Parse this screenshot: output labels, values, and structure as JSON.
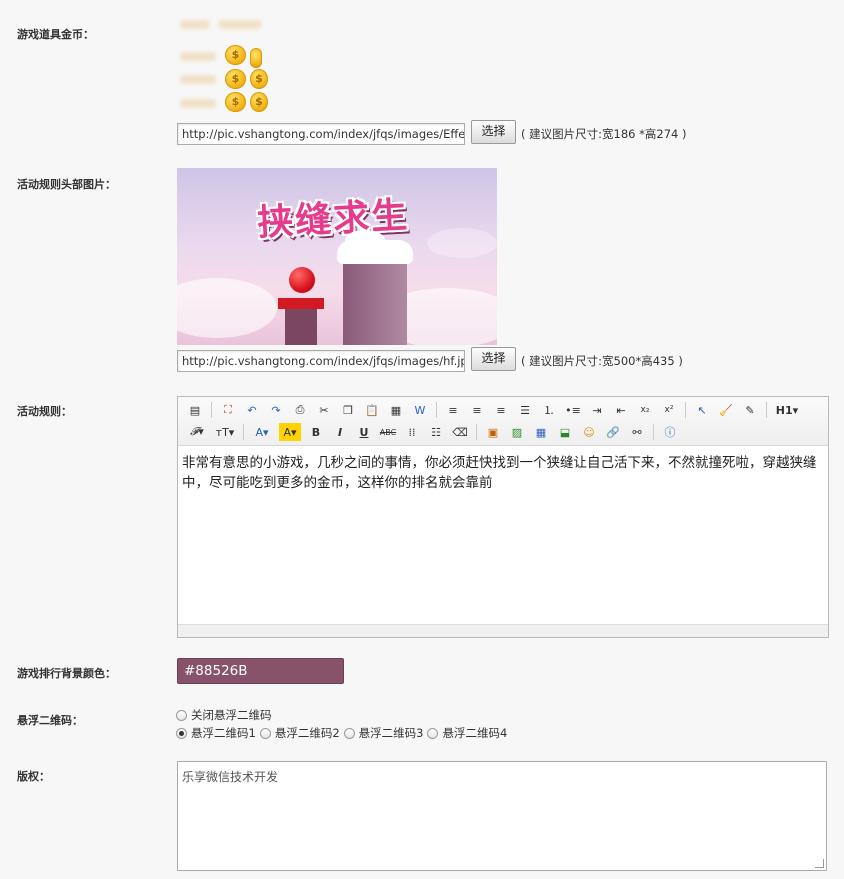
{
  "fields": {
    "coins": {
      "label": "游戏道具金币：",
      "url": "http://pic.vshangtong.com/index/jfqs/images/Effect",
      "button": "选择",
      "hint": "( 建议图片尺寸:宽186 *高274 )"
    },
    "header_image": {
      "label": "活动规则头部图片：",
      "banner_title": "挟缝求生",
      "url": "http://pic.vshangtong.com/index/jfqs/images/hf.jpg",
      "button": "选择",
      "hint": "( 建议图片尺寸:宽500*高435 )"
    },
    "rules": {
      "label": "活动规则：",
      "content": "非常有意思的小游戏，几秒之间的事情，你必须赶快找到一个狭缝让自己活下来，不然就撞死啦，穿越狭缝中，尽可能吃到更多的金币，这样你的排名就会靠前",
      "toolbar_heading": "H1"
    },
    "bg_color": {
      "label": "游戏排行背景颜色：",
      "value": "#88526B"
    },
    "qrcode": {
      "label": "悬浮二维码：",
      "options": [
        "关闭悬浮二维码",
        "悬浮二维码1",
        "悬浮二维码2",
        "悬浮二维码3",
        "悬浮二维码4"
      ],
      "selected": "悬浮二维码1"
    },
    "copyright": {
      "label": "版权：",
      "value": "乐享微信技术开发"
    }
  },
  "colors": {
    "accent": "#88526B",
    "page_bg": "#f7f7f7"
  }
}
